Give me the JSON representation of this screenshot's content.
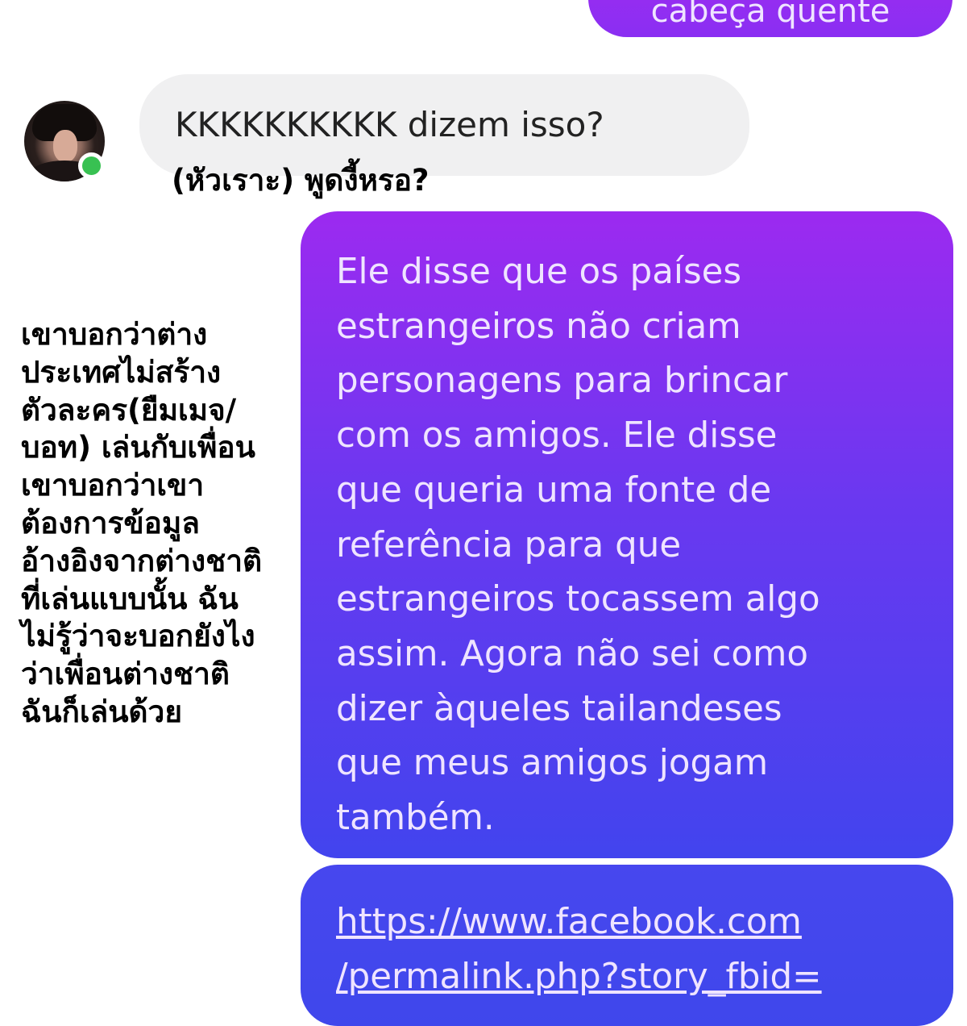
{
  "messages": {
    "top_partial": "cabeça quente",
    "received": "KKKKKKKKKK dizem isso?",
    "sent_main": "Ele disse que os países\nestrangeiros não criam\npersonagens para brincar\ncom os amigos. Ele disse\nque queria uma fonte de\nreferência para que\nestrangeiros tocassem algo\nassim. Agora não sei como\ndizer àqueles tailandeses\nque meus amigos jogam\ntambém.",
    "sent_link": "https://www.facebook.com\n/permalink.php?story_fbid="
  },
  "annotations": {
    "caption": "(หัวเราะ) พูดงี้หรอ?",
    "note": "เขาบอกว่าต่าง\nประเทศไม่สร้าง\nตัวละคร(ยืมเมจ/\nบอท) เล่นกับเพื่อน\nเขาบอกว่าเขา\nต้องการข้อมูล\nอ้างอิงจากต่างชาติ\nที่เล่นแบบนั้น ฉัน\nไม่รู้ว่าจะบอกยังไง\nว่าเพื่อนต่างชาติ\nฉันก็เล่นด้วย"
  },
  "colors": {
    "sent_gradient_top": "#9c2af0",
    "sent_gradient_bottom": "#4244ee",
    "received_bubble": "#f0f0f1",
    "online": "#38c152"
  },
  "icons": {
    "avatar": "avatar",
    "status": "online-status-icon"
  }
}
